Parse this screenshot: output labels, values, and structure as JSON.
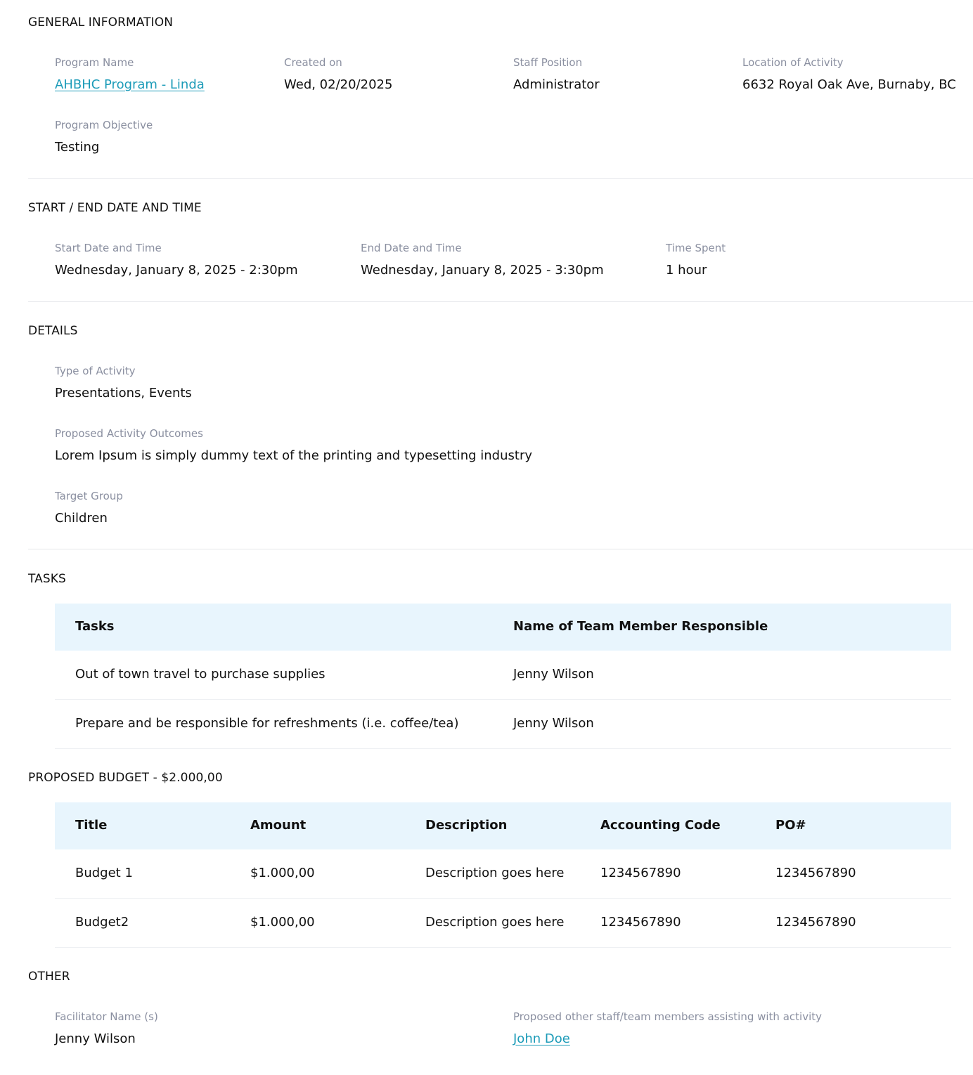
{
  "general": {
    "title": "GENERAL INFORMATION",
    "program_name_label": "Program Name",
    "program_name": "AHBHC Program - Linda",
    "created_on_label": "Created on",
    "created_on": "Wed, 02/20/2025",
    "staff_position_label": "Staff Position",
    "staff_position": "Administrator",
    "location_label": "Location of Activity",
    "location": "6632 Royal Oak Ave, Burnaby, BC",
    "objective_label": "Program Objective",
    "objective": "Testing"
  },
  "datetime": {
    "title": "START / END DATE AND TIME",
    "start_label": "Start Date and Time",
    "start": "Wednesday, January 8, 2025 - 2:30pm",
    "end_label": "End Date and Time",
    "end": "Wednesday, January 8, 2025 - 3:30pm",
    "spent_label": "Time Spent",
    "spent": "1 hour"
  },
  "details": {
    "title": "DETAILS",
    "type_label": "Type of Activity",
    "type": "Presentations, Events",
    "outcomes_label": "Proposed Activity Outcomes",
    "outcomes": "Lorem Ipsum is simply dummy text of the printing and typesetting industry",
    "target_label": "Target Group",
    "target": "Children"
  },
  "tasks": {
    "title": "TASKS",
    "headers": [
      "Tasks",
      "Name of Team Member Responsible"
    ],
    "rows": [
      [
        "Out of town travel to purchase supplies",
        "Jenny Wilson"
      ],
      [
        "Prepare and be responsible for refreshments (i.e. coffee/tea)",
        "Jenny Wilson"
      ]
    ]
  },
  "budget": {
    "title": "PROPOSED BUDGET - $2.000,00",
    "headers": [
      "Title",
      "Amount",
      "Description",
      "Accounting Code",
      "PO#"
    ],
    "rows": [
      [
        "Budget 1",
        "$1.000,00",
        "Description goes here",
        "1234567890",
        "1234567890"
      ],
      [
        "Budget2",
        "$1.000,00",
        "Description goes here",
        "1234567890",
        "1234567890"
      ]
    ]
  },
  "other": {
    "title": "OTHER",
    "facilitator_label": "Facilitator Name (s)",
    "facilitator": "Jenny Wilson",
    "assisting_label": "Proposed other staff/team members assisting with activity",
    "assisting": "John Doe"
  }
}
